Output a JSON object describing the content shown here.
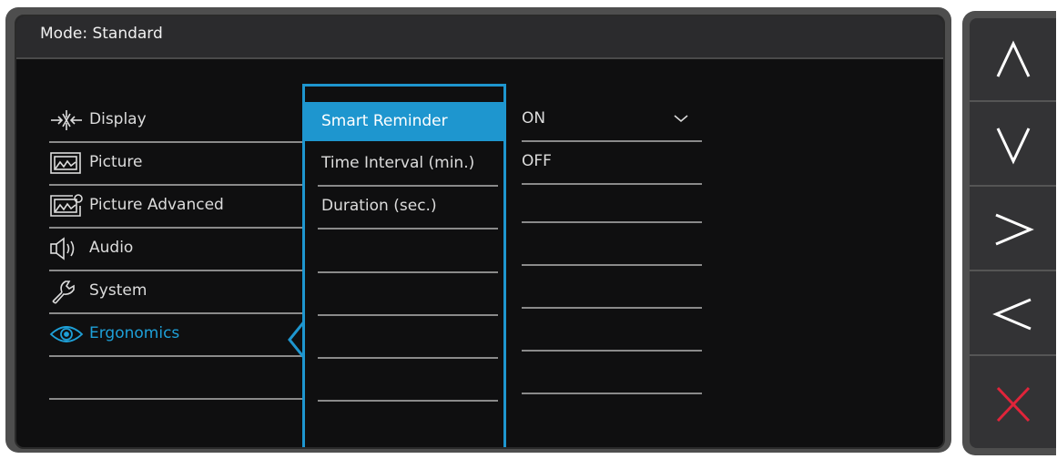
{
  "header": {
    "mode_label": "Mode: Standard"
  },
  "menu": {
    "items": [
      {
        "label": "Display",
        "icon": "display-icon"
      },
      {
        "label": "Picture",
        "icon": "picture-icon"
      },
      {
        "label": "Picture Advanced",
        "icon": "picture-advanced-icon"
      },
      {
        "label": "Audio",
        "icon": "audio-icon"
      },
      {
        "label": "System",
        "icon": "system-wrench-icon"
      },
      {
        "label": "Ergonomics",
        "icon": "eye-icon",
        "active": true
      }
    ]
  },
  "submenu": {
    "items": [
      {
        "label": "Smart Reminder",
        "selected": true
      },
      {
        "label": "Time Interval (min.)"
      },
      {
        "label": "Duration (sec.)"
      }
    ]
  },
  "options": {
    "items": [
      {
        "label": "ON",
        "checked": true
      },
      {
        "label": "OFF"
      }
    ]
  },
  "keypad": {
    "keys": [
      "up-arrow-icon",
      "down-arrow-icon",
      "right-arrow-icon",
      "left-arrow-icon",
      "close-icon"
    ]
  },
  "colors": {
    "accent": "#1e96cf",
    "close": "#e0243a",
    "frame": "#4e4e4e",
    "background": "#0f0f10"
  }
}
